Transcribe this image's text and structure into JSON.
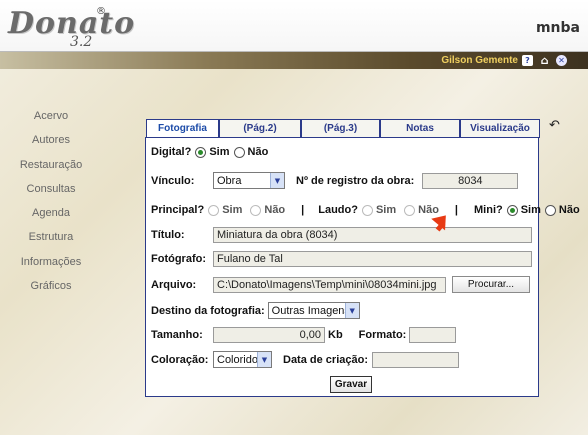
{
  "app": {
    "logo": "Donato",
    "version": "3.2",
    "org": "mnba"
  },
  "userbar": {
    "user": "Gilson Gemente"
  },
  "nav": [
    "Acervo",
    "Autores",
    "Restauração",
    "Consultas",
    "Agenda",
    "Estrutura",
    "Informações",
    "Gráficos"
  ],
  "tabs": [
    "Fotografia",
    "(Pág.2)",
    "(Pág.3)",
    "Notas",
    "Visualização"
  ],
  "form": {
    "digital_label": "Digital?",
    "sim": "Sim",
    "nao": "Não",
    "vinculo_label": "Vínculo:",
    "vinculo_value": "Obra",
    "registro_label": "Nº de registro da obra:",
    "registro_value": "8034",
    "principal_label": "Principal?",
    "laudo_label": "Laudo?",
    "mini_label": "Mini?",
    "sep": "|",
    "titulo_label": "Título:",
    "titulo_value": "Miniatura da obra (8034)",
    "fotografo_label": "Fotógrafo:",
    "fotografo_value": "Fulano de Tal",
    "arquivo_label": "Arquivo:",
    "arquivo_value": "C:\\Donato\\Imagens\\Temp\\mini\\08034mini.jpg",
    "procurar": "Procurar...",
    "destino_label": "Destino da fotografia:",
    "destino_value": "Outras Imagens",
    "tamanho_label": "Tamanho:",
    "tamanho_value": "0,00",
    "kb": "Kb",
    "formato_label": "Formato:",
    "coloracao_label": "Coloração:",
    "coloracao_value": "Colorido",
    "data_label": "Data de criação:",
    "gravar": "Gravar"
  }
}
